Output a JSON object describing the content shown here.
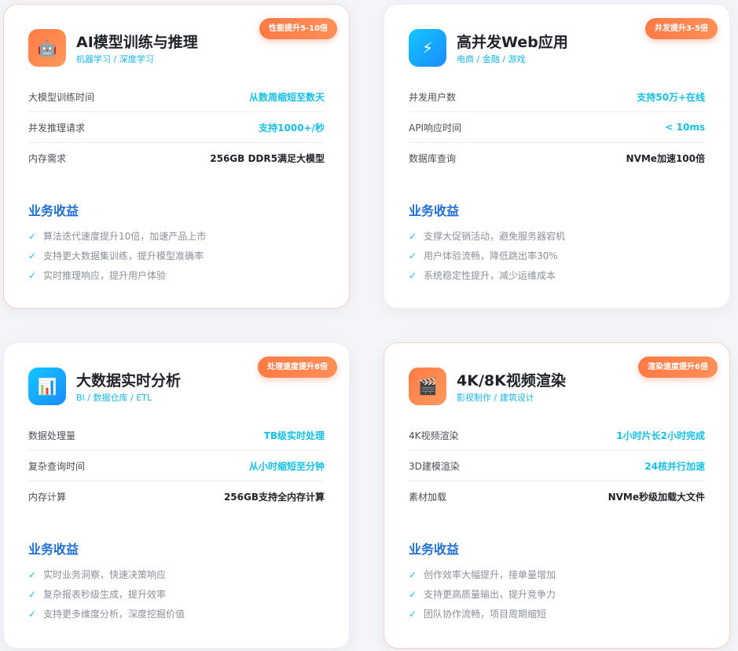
{
  "cards": [
    {
      "title": "AI模型训练与推理",
      "subtitle": "机器学习 / 深度学习",
      "badge": "性能提升5-10倍",
      "icon": "robot-icon",
      "icon_glyph": "🤖",
      "rows": [
        {
          "label": "大模型训练时间",
          "value": "从数周缩短至数天"
        },
        {
          "label": "并发推理请求",
          "value": "支持1000+/秒"
        },
        {
          "label": "内存需求",
          "value": "256GB DDR5满足大模型"
        }
      ],
      "benefit_title": "业务收益",
      "benefits": [
        "算法迭代速度提升10倍，加速产品上市",
        "支持更大数据集训练，提升模型准确率",
        "实时推理响应，提升用户体验"
      ]
    },
    {
      "title": "高并发Web应用",
      "subtitle": "电商 / 金融 / 游戏",
      "badge": "并发提升3-5倍",
      "icon": "lightning-icon",
      "icon_glyph": "⚡",
      "rows": [
        {
          "label": "并发用户数",
          "value": "支持50万+在线"
        },
        {
          "label": "API响应时间",
          "value": "< 10ms"
        },
        {
          "label": "数据库查询",
          "value": "NVMe加速100倍"
        }
      ],
      "benefit_title": "业务收益",
      "benefits": [
        "支撑大促销活动，避免服务器宕机",
        "用户体验流畅，降低跳出率30%",
        "系统稳定性提升，减少运维成本"
      ]
    },
    {
      "title": "大数据实时分析",
      "subtitle": "BI / 数据仓库 / ETL",
      "badge": "处理速度提升8倍",
      "icon": "bar-chart-icon",
      "icon_glyph": "📊",
      "rows": [
        {
          "label": "数据处理量",
          "value": "TB级实时处理"
        },
        {
          "label": "复杂查询时间",
          "value": "从小时缩短至分钟"
        },
        {
          "label": "内存计算",
          "value": "256GB支持全内存计算"
        }
      ],
      "benefit_title": "业务收益",
      "benefits": [
        "实时业务洞察，快速决策响应",
        "复杂报表秒级生成，提升效率",
        "支持更多维度分析，深度挖掘价值"
      ]
    },
    {
      "title": "4K/8K视频渲染",
      "subtitle": "影视制作 / 建筑设计",
      "badge": "渲染速度提升6倍",
      "icon": "clapperboard-icon",
      "icon_glyph": "🎬",
      "rows": [
        {
          "label": "4K视频渲染",
          "value": "1小时片长2小时完成"
        },
        {
          "label": "3D建模渲染",
          "value": "24核并行加速"
        },
        {
          "label": "素材加载",
          "value": "NVMe秒级加载大文件"
        }
      ],
      "benefit_title": "业务收益",
      "benefits": [
        "创作效率大幅提升，接单量增加",
        "支持更高质量输出，提升竞争力",
        "团队协作流畅，项目周期缩短"
      ]
    }
  ]
}
